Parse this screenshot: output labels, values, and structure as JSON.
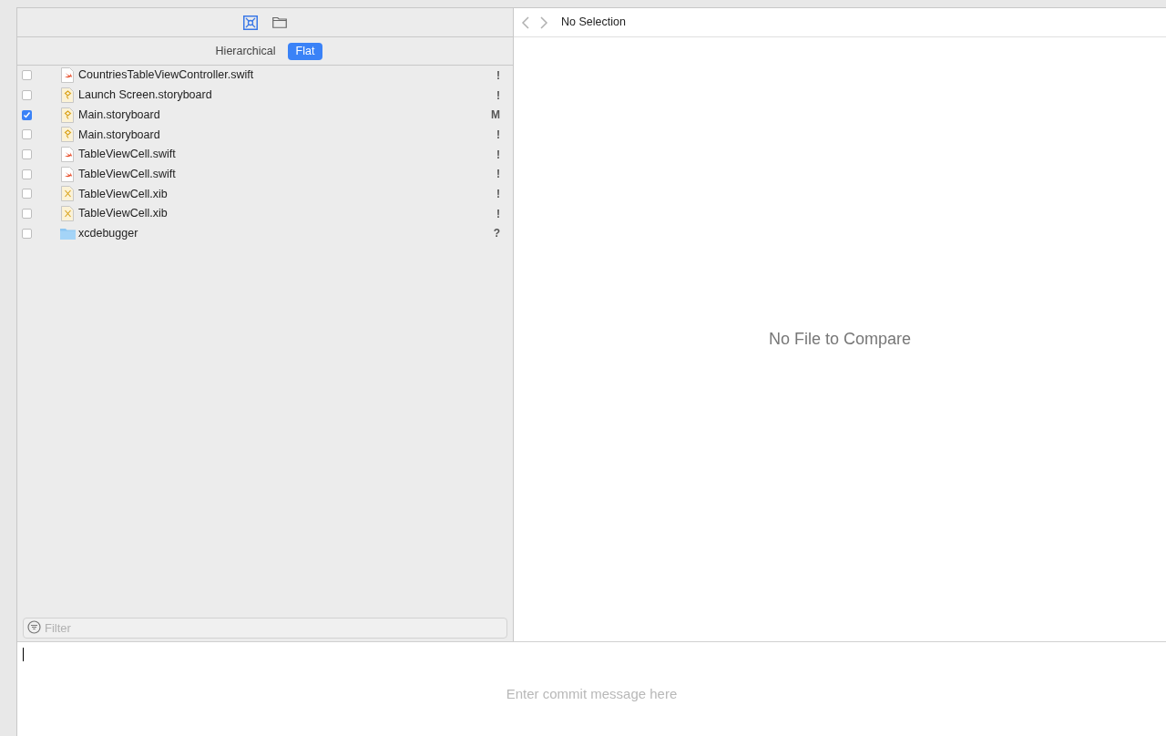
{
  "navigator": {
    "view_icons": [
      {
        "kind": "source-control",
        "selected": true
      },
      {
        "kind": "folder",
        "selected": false
      }
    ],
    "segments": [
      {
        "label": "Hierarchical",
        "selected": false
      },
      {
        "label": "Flat",
        "selected": true
      }
    ],
    "files": [
      {
        "name": "CountriesTableViewController.swift",
        "kind": "swift",
        "checked": false,
        "status": "!"
      },
      {
        "name": "Launch Screen.storyboard",
        "kind": "storyboard",
        "checked": false,
        "status": "!"
      },
      {
        "name": "Main.storyboard",
        "kind": "storyboard",
        "checked": true,
        "status": "M"
      },
      {
        "name": "Main.storyboard",
        "kind": "storyboard",
        "checked": false,
        "status": "!"
      },
      {
        "name": "TableViewCell.swift",
        "kind": "swift",
        "checked": false,
        "status": "!"
      },
      {
        "name": "TableViewCell.swift",
        "kind": "swift",
        "checked": false,
        "status": "!"
      },
      {
        "name": "TableViewCell.xib",
        "kind": "xib",
        "checked": false,
        "status": "!"
      },
      {
        "name": "TableViewCell.xib",
        "kind": "xib",
        "checked": false,
        "status": "!"
      },
      {
        "name": "xcdebugger",
        "kind": "folder",
        "checked": false,
        "status": "?"
      }
    ],
    "filter": {
      "placeholder": "Filter"
    }
  },
  "editor": {
    "title": "No Selection",
    "empty_message": "No File to Compare"
  },
  "commit": {
    "placeholder": "Enter commit message here"
  }
}
